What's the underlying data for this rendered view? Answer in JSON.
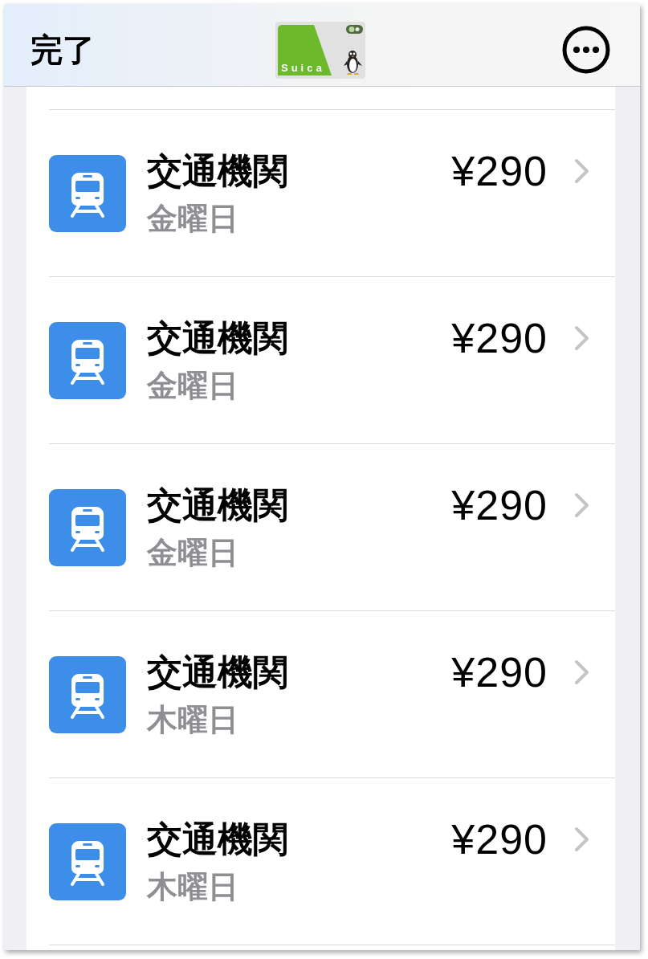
{
  "nav_bar": {
    "done_button": "完了",
    "card": {
      "logo_text": "Suica"
    }
  },
  "transactions": [
    {
      "title": "交通機関",
      "day": "金曜日",
      "amount": "¥290"
    },
    {
      "title": "交通機関",
      "day": "金曜日",
      "amount": "¥290"
    },
    {
      "title": "交通機関",
      "day": "金曜日",
      "amount": "¥290"
    },
    {
      "title": "交通機関",
      "day": "木曜日",
      "amount": "¥290"
    },
    {
      "title": "交通機関",
      "day": "木曜日",
      "amount": "¥290"
    }
  ]
}
